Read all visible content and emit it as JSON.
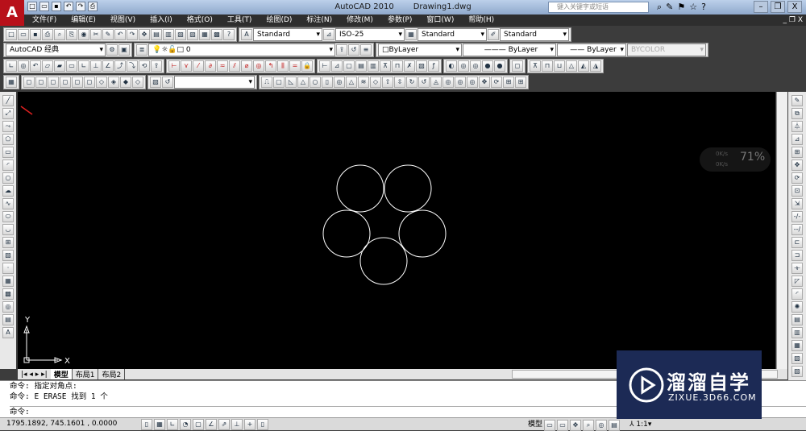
{
  "titlebar": {
    "app": "AutoCAD 2010",
    "file": "Drawing1.dwg",
    "search_placeholder": "键入关键字或短语",
    "logo": "A"
  },
  "menu": [
    "文件(F)",
    "编辑(E)",
    "视图(V)",
    "插入(I)",
    "格式(O)",
    "工具(T)",
    "绘图(D)",
    "标注(N)",
    "修改(M)",
    "参数(P)",
    "窗口(W)",
    "帮助(H)"
  ],
  "menu_right": "_ ❐ X",
  "styles": {
    "text_style": "Standard",
    "dim_style": "ISO-25",
    "table_style": "Standard",
    "mleader_style": "Standard"
  },
  "workspace": "AutoCAD 经典",
  "layer": "0",
  "properties": {
    "color": "ByLayer",
    "linetype": "ByLayer",
    "lineweight": "ByLayer",
    "plotstyle": "BYCOLOR"
  },
  "visual_style": "",
  "tabs": [
    "模型",
    "布局1",
    "布局2"
  ],
  "command": {
    "lines": [
      "命令: 指定对角点:",
      "命令: E ERASE 找到 1 个"
    ],
    "prompt": "命令:"
  },
  "status": {
    "coords": "1795.1892, 745.1601 , 0.0000",
    "model": "模型",
    "scale": "1:1"
  },
  "ucs": {
    "x": "X",
    "y": "Y"
  },
  "netmon": {
    "up": "0K/s",
    "down": "0K/s",
    "percent": "71%"
  },
  "watermark": {
    "name": "溜溜自学",
    "url": "ZIXUE.3D66.COM"
  }
}
